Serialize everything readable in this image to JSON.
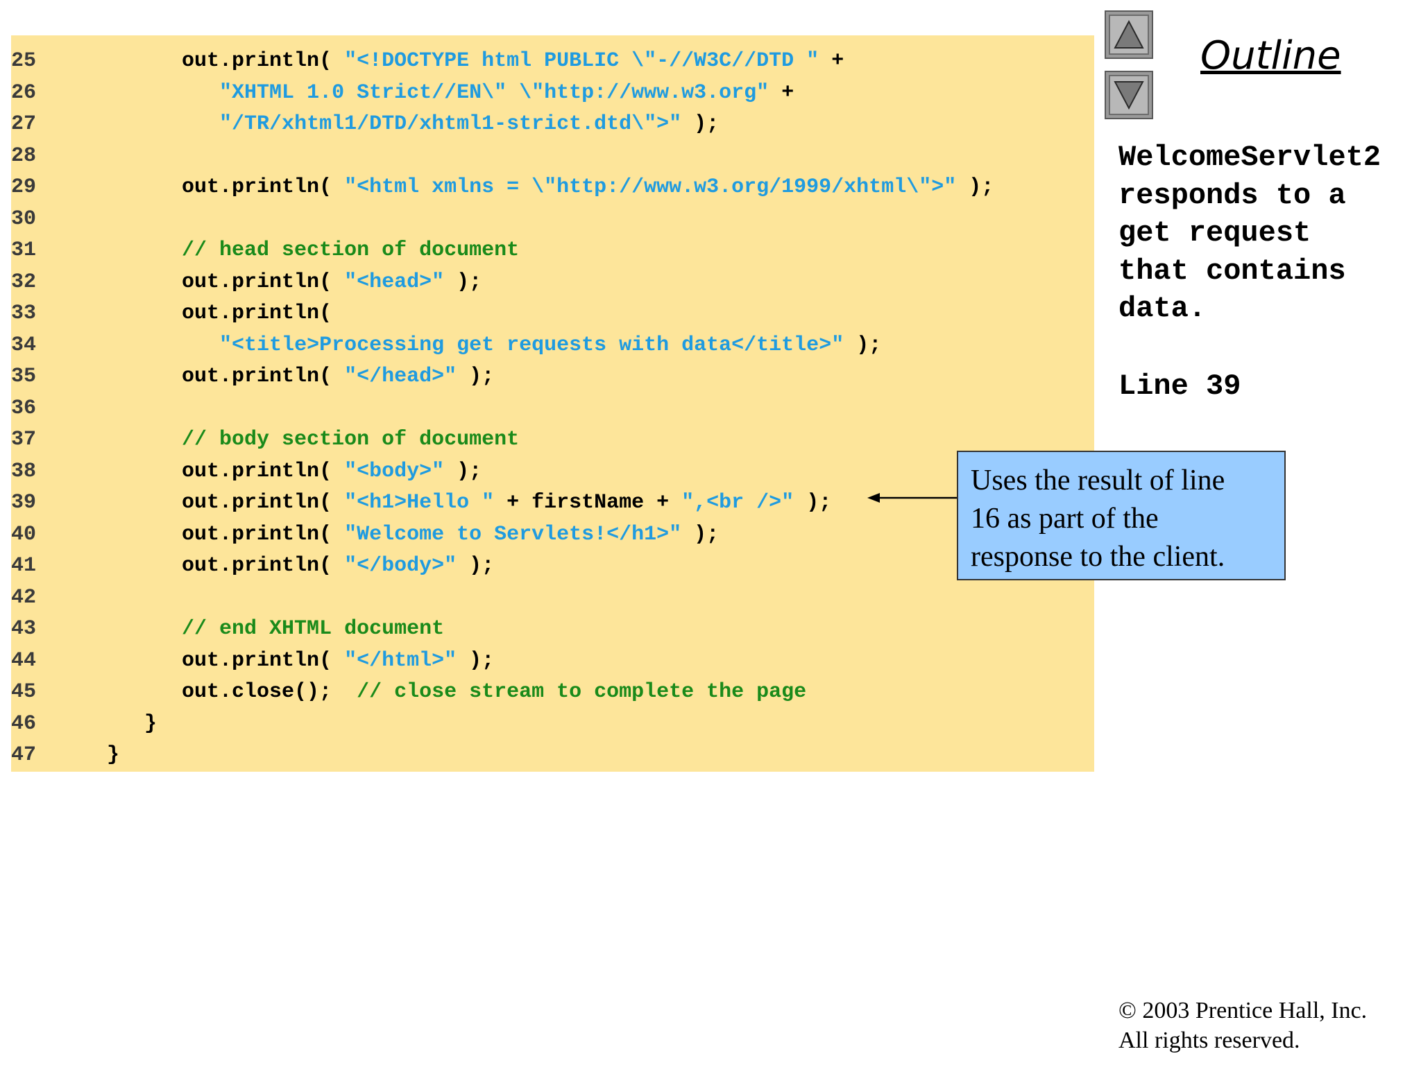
{
  "nav": {
    "up_icon": "triangle-up-icon",
    "down_icon": "triangle-down-icon"
  },
  "outline_title": "Outline",
  "side": {
    "description": [
      "WelcomeServlet2",
      "responds to a",
      "get request",
      "that contains",
      "data."
    ],
    "line_ref": "Line 39"
  },
  "callout": {
    "lines": [
      "Uses the result of line",
      "16 as part of the",
      "response to the client."
    ]
  },
  "footer": {
    "copyright": "© 2003 Prentice Hall, Inc.",
    "rights": "All rights reserved."
  },
  "code": [
    {
      "num": "25",
      "tokens": [
        {
          "t": "        out.println( ",
          "k": "c"
        },
        {
          "t": "\"<!DOCTYPE html PUBLIC \\\"-//W3C//DTD \"",
          "k": "s"
        },
        {
          "t": " +",
          "k": "c"
        }
      ]
    },
    {
      "num": "26",
      "tokens": [
        {
          "t": "           ",
          "k": "c"
        },
        {
          "t": "\"XHTML 1.0 Strict//EN\\\" \\\"http://www.w3.org\"",
          "k": "s"
        },
        {
          "t": " +",
          "k": "c"
        }
      ]
    },
    {
      "num": "27",
      "tokens": [
        {
          "t": "           ",
          "k": "c"
        },
        {
          "t": "\"/TR/xhtml1/DTD/xhtml1-strict.dtd\\\">\"",
          "k": "s"
        },
        {
          "t": " );",
          "k": "c"
        }
      ]
    },
    {
      "num": "28",
      "tokens": []
    },
    {
      "num": "29",
      "tokens": [
        {
          "t": "        out.println( ",
          "k": "c"
        },
        {
          "t": "\"<html xmlns = \\\"http://www.w3.org/1999/xhtml\\\">\"",
          "k": "s"
        },
        {
          "t": " );",
          "k": "c"
        }
      ]
    },
    {
      "num": "30",
      "tokens": []
    },
    {
      "num": "31",
      "tokens": [
        {
          "t": "        ",
          "k": "c"
        },
        {
          "t": "// head section of document",
          "k": "m"
        }
      ]
    },
    {
      "num": "32",
      "tokens": [
        {
          "t": "        out.println( ",
          "k": "c"
        },
        {
          "t": "\"<head>\"",
          "k": "s"
        },
        {
          "t": " );",
          "k": "c"
        }
      ]
    },
    {
      "num": "33",
      "tokens": [
        {
          "t": "        out.println(",
          "k": "c"
        }
      ]
    },
    {
      "num": "34",
      "tokens": [
        {
          "t": "           ",
          "k": "c"
        },
        {
          "t": "\"<title>Processing get requests with data</title>\"",
          "k": "s"
        },
        {
          "t": " );",
          "k": "c"
        }
      ]
    },
    {
      "num": "35",
      "tokens": [
        {
          "t": "        out.println( ",
          "k": "c"
        },
        {
          "t": "\"</head>\"",
          "k": "s"
        },
        {
          "t": " );",
          "k": "c"
        }
      ]
    },
    {
      "num": "36",
      "tokens": []
    },
    {
      "num": "37",
      "tokens": [
        {
          "t": "        ",
          "k": "c"
        },
        {
          "t": "// body section of document",
          "k": "m"
        }
      ]
    },
    {
      "num": "38",
      "tokens": [
        {
          "t": "        out.println( ",
          "k": "c"
        },
        {
          "t": "\"<body>\"",
          "k": "s"
        },
        {
          "t": " );",
          "k": "c"
        }
      ]
    },
    {
      "num": "39",
      "tokens": [
        {
          "t": "        out.println( ",
          "k": "c"
        },
        {
          "t": "\"<h1>Hello \"",
          "k": "s"
        },
        {
          "t": " + firstName + ",
          "k": "c"
        },
        {
          "t": "\",<br />\"",
          "k": "s"
        },
        {
          "t": " );",
          "k": "c"
        }
      ]
    },
    {
      "num": "40",
      "tokens": [
        {
          "t": "        out.println( ",
          "k": "c"
        },
        {
          "t": "\"Welcome to Servlets!</h1>\"",
          "k": "s"
        },
        {
          "t": " );",
          "k": "c"
        }
      ]
    },
    {
      "num": "41",
      "tokens": [
        {
          "t": "        out.println( ",
          "k": "c"
        },
        {
          "t": "\"</body>\"",
          "k": "s"
        },
        {
          "t": " );",
          "k": "c"
        }
      ]
    },
    {
      "num": "42",
      "tokens": []
    },
    {
      "num": "43",
      "tokens": [
        {
          "t": "        ",
          "k": "c"
        },
        {
          "t": "// end XHTML document",
          "k": "m"
        }
      ]
    },
    {
      "num": "44",
      "tokens": [
        {
          "t": "        out.println( ",
          "k": "c"
        },
        {
          "t": "\"</html>\"",
          "k": "s"
        },
        {
          "t": " );",
          "k": "c"
        }
      ]
    },
    {
      "num": "45",
      "tokens": [
        {
          "t": "        out.close();  ",
          "k": "c"
        },
        {
          "t": "// close stream to complete the page",
          "k": "m"
        }
      ]
    },
    {
      "num": "46",
      "tokens": [
        {
          "t": "     }",
          "k": "c"
        }
      ]
    },
    {
      "num": "47",
      "tokens": [
        {
          "t": "  }",
          "k": "c"
        }
      ]
    }
  ]
}
